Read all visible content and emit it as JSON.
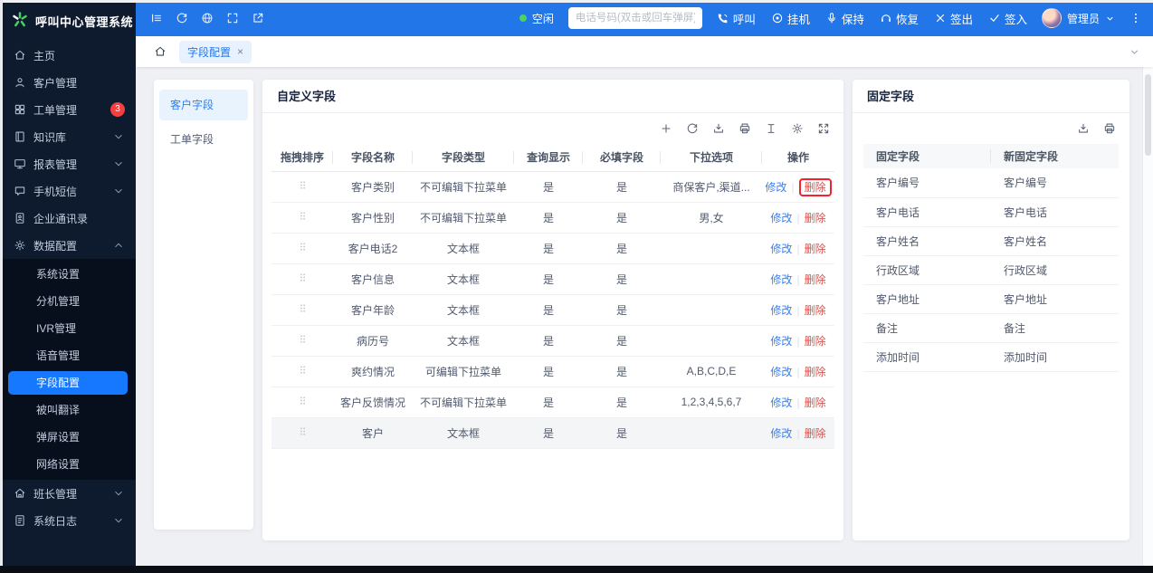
{
  "app": {
    "logo_title": "呼叫中心管理系统"
  },
  "topbar": {
    "left_icons": [
      "collapse-menu-icon",
      "refresh-icon",
      "globe-icon",
      "fullscreen-icon",
      "external-link-icon"
    ],
    "status": {
      "label": "空闲",
      "color": "#4cd263"
    },
    "phone_input": {
      "value": "",
      "placeholder": "电话号码(双击或回车弹屏)"
    },
    "actions": [
      {
        "id": "call",
        "label": "呼叫",
        "icon": "phone-call-icon"
      },
      {
        "id": "hangup",
        "label": "挂机",
        "icon": "hangup-icon"
      },
      {
        "id": "hold",
        "label": "保持",
        "icon": "mic-icon"
      },
      {
        "id": "resume",
        "label": "恢复",
        "icon": "headset-icon"
      },
      {
        "id": "signout",
        "label": "签出",
        "icon": "x-icon"
      },
      {
        "id": "signin",
        "label": "签入",
        "icon": "check-icon"
      }
    ],
    "user": {
      "name": "管理员"
    }
  },
  "tabbar": {
    "tabs": [
      {
        "label": "字段配置",
        "active": true,
        "closable": true
      }
    ]
  },
  "sidebar": {
    "items": [
      {
        "label": "主页",
        "icon": "home-icon"
      },
      {
        "label": "客户管理",
        "icon": "user-icon"
      },
      {
        "label": "工单管理",
        "icon": "grid-icon",
        "badge": "3"
      },
      {
        "label": "知识库",
        "icon": "book-icon",
        "chevron": "down"
      },
      {
        "label": "报表管理",
        "icon": "monitor-icon",
        "chevron": "down"
      },
      {
        "label": "手机短信",
        "icon": "message-icon",
        "chevron": "down"
      },
      {
        "label": "企业通讯录",
        "icon": "contacts-icon"
      },
      {
        "label": "数据配置",
        "icon": "gear-icon",
        "chevron": "up",
        "expanded": true,
        "children": [
          {
            "label": "系统设置"
          },
          {
            "label": "分机管理"
          },
          {
            "label": "IVR管理"
          },
          {
            "label": "语音管理"
          },
          {
            "label": "字段配置",
            "active": true
          },
          {
            "label": "被叫翻译"
          },
          {
            "label": "弹屏设置"
          },
          {
            "label": "网络设置"
          }
        ]
      },
      {
        "label": "班长管理",
        "icon": "team-icon",
        "chevron": "down"
      },
      {
        "label": "系统日志",
        "icon": "log-icon",
        "chevron": "down"
      }
    ]
  },
  "field_tabs": {
    "items": [
      {
        "label": "客户字段",
        "active": true
      },
      {
        "label": "工单字段",
        "active": false
      }
    ]
  },
  "custom_fields": {
    "title": "自定义字段",
    "toolbar_icons": [
      "plus-icon",
      "refresh-icon",
      "download-icon",
      "print-icon",
      "row-height-icon",
      "gear-icon",
      "expand-icon"
    ],
    "columns": [
      "拖拽排序",
      "字段名称",
      "字段类型",
      "查询显示",
      "必填字段",
      "下拉选项",
      "操作"
    ],
    "edit_label": "修改",
    "delete_label": "删除",
    "rows": [
      {
        "name": "客户类别",
        "type": "不可编辑下拉菜单",
        "query_display": "是",
        "required": "是",
        "options": "商保客户,渠道...",
        "delete_highlighted": true
      },
      {
        "name": "客户性别",
        "type": "不可编辑下拉菜单",
        "query_display": "是",
        "required": "是",
        "options": "男,女"
      },
      {
        "name": "客户电话2",
        "type": "文本框",
        "query_display": "是",
        "required": "是",
        "options": ""
      },
      {
        "name": "客户信息",
        "type": "文本框",
        "query_display": "是",
        "required": "是",
        "options": ""
      },
      {
        "name": "客户年龄",
        "type": "文本框",
        "query_display": "是",
        "required": "是",
        "options": ""
      },
      {
        "name": "病历号",
        "type": "文本框",
        "query_display": "是",
        "required": "是",
        "options": ""
      },
      {
        "name": "爽约情况",
        "type": "可编辑下拉菜单",
        "query_display": "是",
        "required": "是",
        "options": "A,B,C,D,E"
      },
      {
        "name": "客户反馈情况",
        "type": "不可编辑下拉菜单",
        "query_display": "是",
        "required": "是",
        "options": "1,2,3,4,5,6,7"
      },
      {
        "name": "客户",
        "type": "文本框",
        "query_display": "是",
        "required": "是",
        "options": "",
        "hovered": true
      }
    ]
  },
  "fixed_fields": {
    "title": "固定字段",
    "toolbar_icons": [
      "download-icon",
      "print-icon"
    ],
    "columns": [
      "固定字段",
      "新固定字段"
    ],
    "rows": [
      {
        "old": "客户编号",
        "new": "客户编号"
      },
      {
        "old": "客户电话",
        "new": "客户电话"
      },
      {
        "old": "客户姓名",
        "new": "客户姓名"
      },
      {
        "old": "行政区域",
        "new": "行政区域"
      },
      {
        "old": "客户地址",
        "new": "客户地址"
      },
      {
        "old": "备注",
        "new": "备注"
      },
      {
        "old": "添加时间",
        "new": "添加时间"
      }
    ]
  },
  "colors": {
    "header_blue": "#2376e8",
    "active_menu_blue": "#1677ff",
    "sidebar_bg": "#0e1a2e",
    "submenu_bg": "#070e1c",
    "badge_red": "#f53f3f",
    "status_green": "#4cd263",
    "link_blue": "#3a7ff2",
    "danger_red": "#f0483e",
    "highlight_box_red": "#f5222d",
    "content_bg": "#eef0f4"
  }
}
